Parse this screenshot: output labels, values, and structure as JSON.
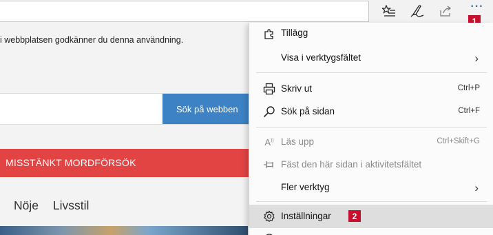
{
  "browser": {
    "toolbar": {
      "favorites_icon": "favorites-list-icon",
      "notes_icon": "pen-icon",
      "share_icon": "share-icon",
      "more_icon": "more-icon",
      "more_glyph": "···"
    }
  },
  "badges": {
    "first": "1",
    "second": "2"
  },
  "page": {
    "notice_text": "i webbplatsen godkänner du denna användning.",
    "search_button": "Sök på webben",
    "alert_text": "MISSTÄNKT MORDFÖRSÖK",
    "nav_links": [
      "Nöje",
      "Livsstil"
    ]
  },
  "menu": {
    "extensions": "Tillägg",
    "show_in_toolbar": "Visa i verktygsfältet",
    "print": "Skriv ut",
    "print_shortcut": "Ctrl+P",
    "find": "Sök på sidan",
    "find_shortcut": "Ctrl+F",
    "read_aloud": "Läs upp",
    "read_aloud_shortcut": "Ctrl+Skift+G",
    "pin_taskbar": "Fäst den här sidan i aktivitetsfältet",
    "more_tools": "Fler verktyg",
    "settings": "Inställningar"
  },
  "colors": {
    "badge": "#c8102e",
    "search_button": "#3d82c4",
    "alert_bar": "#e24444",
    "menu_highlight": "#dedede"
  }
}
